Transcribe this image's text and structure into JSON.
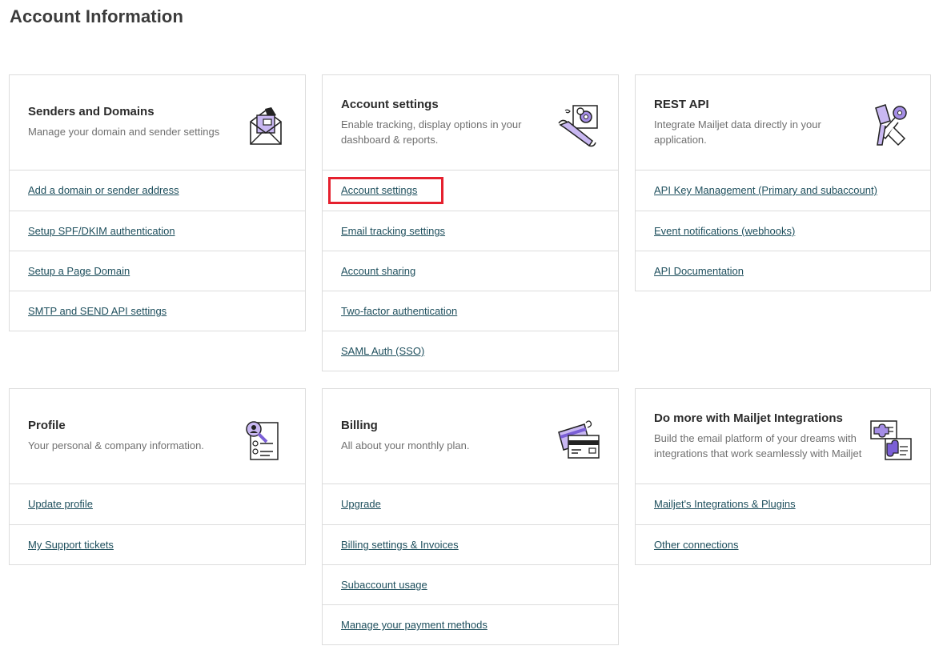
{
  "page": {
    "title": "Account Information"
  },
  "cards": {
    "senders": {
      "title": "Senders and Domains",
      "desc": "Manage your domain and sender settings",
      "icon": "envelope-letter-icon",
      "links": [
        "Add a domain or sender address",
        "Setup SPF/DKIM authentication",
        "Setup a Page Domain",
        "SMTP and SEND API settings"
      ]
    },
    "account": {
      "title": "Account settings",
      "desc": "Enable tracking, display options in your dashboard & reports.",
      "icon": "wrench-gear-icon",
      "links": [
        "Account settings",
        "Email tracking settings",
        "Account sharing",
        "Two-factor authentication",
        "SAML Auth (SSO)"
      ]
    },
    "rest": {
      "title": "REST API",
      "desc": "Integrate Mailjet data directly in your application.",
      "icon": "keys-icon",
      "links": [
        "API Key Management (Primary and subaccount)",
        "Event notifications (webhooks)",
        "API Documentation"
      ]
    },
    "profile": {
      "title": "Profile",
      "desc": "Your personal & company information.",
      "icon": "profile-magnifier-icon",
      "links": [
        "Update profile",
        "My Support tickets"
      ]
    },
    "billing": {
      "title": "Billing",
      "desc": "All about your monthly plan.",
      "icon": "credit-cards-icon",
      "links": [
        "Upgrade",
        "Billing settings & Invoices",
        "Subaccount usage",
        "Manage your payment methods"
      ]
    },
    "integrations": {
      "title": "Do more with Mailjet Integrations",
      "desc": "Build the email platform of your dreams with integrations that work seamlessly with Mailjet",
      "icon": "puzzle-cards-icon",
      "links": [
        "Mailjet's Integrations & Plugins",
        "Other connections"
      ]
    }
  },
  "colors": {
    "accent": "#a58ee6",
    "link": "#1e4f5d",
    "highlight": "#e5202e",
    "border": "#dcdcdc"
  }
}
